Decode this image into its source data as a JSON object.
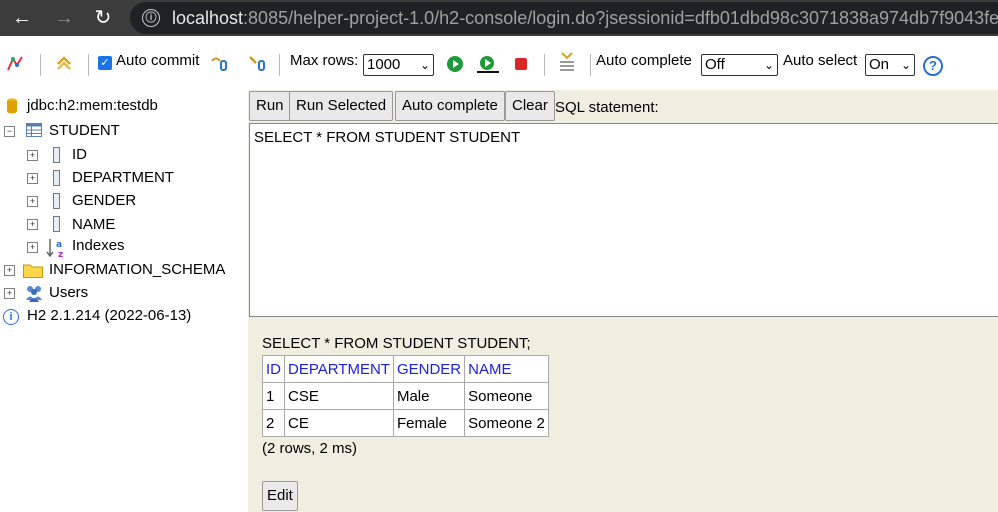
{
  "browser": {
    "url_host": "localhost",
    "url_rest": ":8085/helper-project-1.0/h2-console/login.do?jsessionid=dfb01dbd98c3071838a974db7f9043fe",
    "info_icon": "ⓘ"
  },
  "toolbar": {
    "auto_commit_label": "Auto commit",
    "max_rows_label": "Max rows:",
    "max_rows_value": "1000",
    "auto_complete_label": "Auto complete",
    "auto_complete_value": "Off",
    "auto_select_label": "Auto select",
    "auto_select_value": "On",
    "help_icon": "?"
  },
  "tree": {
    "connection": "jdbc:h2:mem:testdb",
    "table": "STUDENT",
    "columns": [
      "ID",
      "DEPARTMENT",
      "GENDER",
      "NAME"
    ],
    "indexes": "Indexes",
    "schema": "INFORMATION_SCHEMA",
    "users": "Users",
    "version": "H2 2.1.214 (2022-06-13)"
  },
  "editor": {
    "run": "Run",
    "run_selected": "Run Selected",
    "auto_complete": "Auto complete",
    "clear": "Clear",
    "sql_label": "SQL statement:",
    "sql_text": "SELECT * FROM STUDENT STUDENT"
  },
  "result": {
    "query": "SELECT * FROM STUDENT STUDENT;",
    "headers": [
      "ID",
      "DEPARTMENT",
      "GENDER",
      "NAME"
    ],
    "rows": [
      [
        "1",
        "CSE",
        "Male",
        "Someone"
      ],
      [
        "2",
        "CE",
        "Female",
        "Someone 2"
      ]
    ],
    "summary": "(2 rows, 2 ms)",
    "edit": "Edit"
  }
}
